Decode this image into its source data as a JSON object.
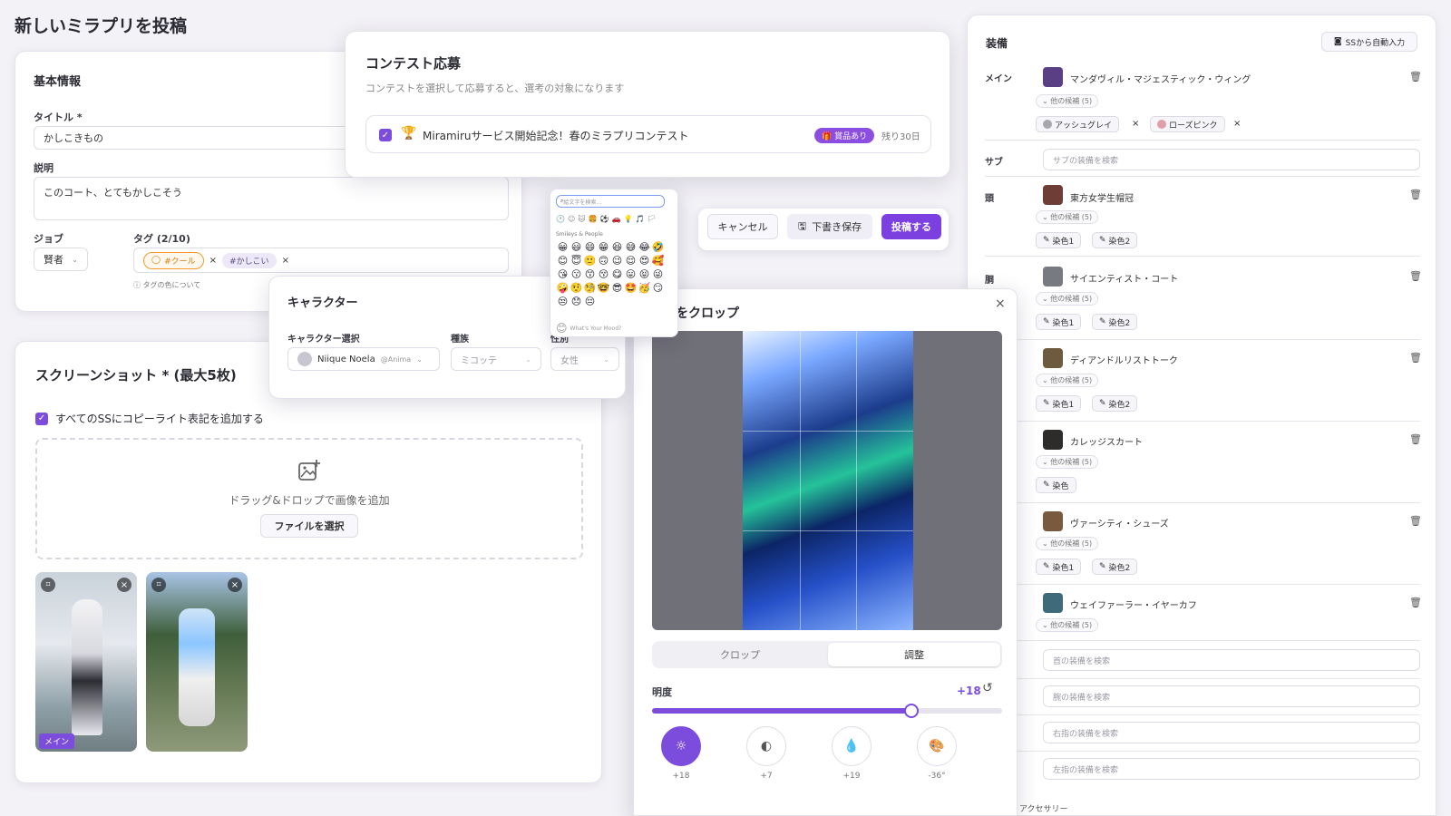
{
  "page": {
    "title": "新しいミラプリを投稿"
  },
  "basic": {
    "heading": "基本情報",
    "title_label": "タイトル *",
    "title_value": "かしこきもの",
    "desc_label": "説明",
    "desc_value": "このコート、とてもかしこそう",
    "job_label": "ジョブ",
    "job_value": "賢者",
    "tags_label": "タグ (2/10)",
    "tags": [
      "#クール",
      "#かしこい"
    ],
    "tag_help": "タグの色について"
  },
  "contest": {
    "heading": "コンテスト応募",
    "subtitle": "コンテストを選択して応募すると、選考の対象になります",
    "item_name": "Miramiruサービス開始記念！春のミラプリコンテスト",
    "badge": "賞品あり",
    "remaining": "残り30日"
  },
  "actions": {
    "cancel": "キャンセル",
    "draft": "下書き保存",
    "submit": "投稿する"
  },
  "character": {
    "heading": "キャラクター",
    "select_label": "キャラクター選択",
    "select_name": "Niique Noela",
    "select_handle": "@Anima",
    "race_label": "種族",
    "race_value": "ミコッテ",
    "gender_label": "性別",
    "gender_value": "女性"
  },
  "emoji_picker": {
    "search_placeholder": "絵文字を検索...",
    "section": "Smileys & People",
    "footer": "What's Your Mood?",
    "emojis": [
      "😀",
      "😃",
      "😄",
      "😁",
      "😆",
      "😅",
      "😂",
      "🤣",
      "😊",
      "😇",
      "🙂",
      "🙃",
      "😉",
      "😌",
      "😍",
      "🥰",
      "😘",
      "😗",
      "😙",
      "😚",
      "😋",
      "😛",
      "😝",
      "😜",
      "🤪",
      "🤨",
      "🧐",
      "🤓",
      "😎",
      "🤩",
      "🥳",
      "😏",
      "😒",
      "😞",
      "😔"
    ]
  },
  "screenshots": {
    "heading": "スクリーンショット * (最大5枚)",
    "copyright_label": "すべてのSSにコピーライト表記を追加する",
    "drop_text": "ドラッグ&ドロップで画像を追加",
    "choose_file": "ファイルを選択",
    "main_badge": "メイン"
  },
  "crop": {
    "title": "をクロップ",
    "tab_crop": "クロップ",
    "tab_adjust": "調整",
    "brightness_label": "明度",
    "brightness_value": "+18",
    "brightness_level": 0.74,
    "knobs": [
      "+18",
      "+7",
      "+19",
      "-36°"
    ],
    "accessory_label": "アクセサリー"
  },
  "equipment": {
    "heading": "装備",
    "auto_btn": "SSから自動入力",
    "main_label": "メイン",
    "main_name": "マンダヴィル・マジェスティック・ウィング",
    "more": "他の候補 (5)",
    "main_dyes": [
      "アッシュグレイ",
      "ローズピンク"
    ],
    "sub_label": "サブ",
    "sub_placeholder": "サブの装備を検索",
    "head_label": "頭",
    "head_name": "東方女学生帽冠",
    "body_label": "胴",
    "body_name": "サイエンティスト・コート",
    "hands_name": "ディアンドルリストトーク",
    "legs_name": "カレッジスカート",
    "feet_name": "ヴァーシティ・シューズ",
    "ear_name": "ウェイファーラー・イヤーカフ",
    "dye1": "染色1",
    "dye2": "染色2",
    "dye": "染色",
    "neck_placeholder": "首の装備を検索",
    "wrist_placeholder": "腕の装備を検索",
    "rring_placeholder": "右指の装備を検索",
    "lring_placeholder": "左指の装備を検索"
  },
  "colors": {
    "accent": "#7c4ddd",
    "tag_orange": "#f29a2e"
  }
}
